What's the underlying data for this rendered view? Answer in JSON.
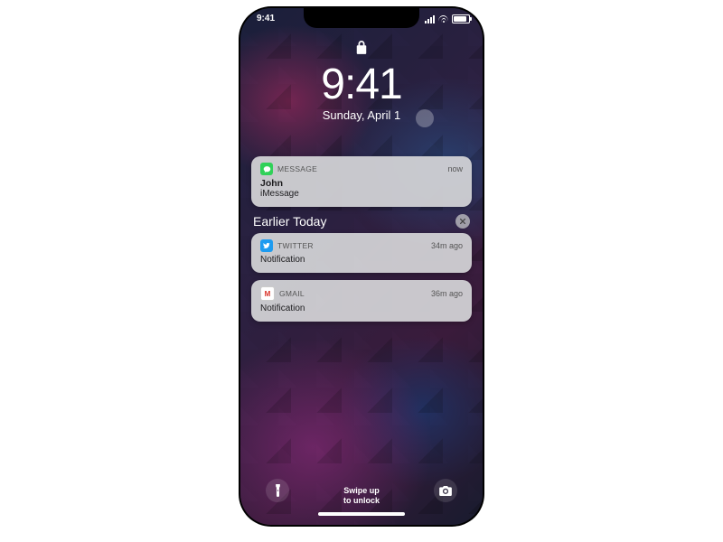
{
  "status_bar": {
    "time": "9:41"
  },
  "lock": {
    "big_time": "9:41",
    "date": "Sunday, April 1"
  },
  "notifications": {
    "recent": [
      {
        "app": "MESSAGE",
        "time": "now",
        "sender": "John",
        "preview": "iMessage",
        "icon": "message"
      }
    ],
    "section_label": "Earlier Today",
    "earlier": [
      {
        "app": "TWITTER",
        "time": "34m ago",
        "preview": "Notification",
        "icon": "twitter"
      },
      {
        "app": "GMAIL",
        "time": "36m ago",
        "preview": "Notification",
        "icon": "gmail"
      }
    ]
  },
  "bottom": {
    "swipe_line1": "Swipe up",
    "swipe_line2": "to unlock"
  }
}
